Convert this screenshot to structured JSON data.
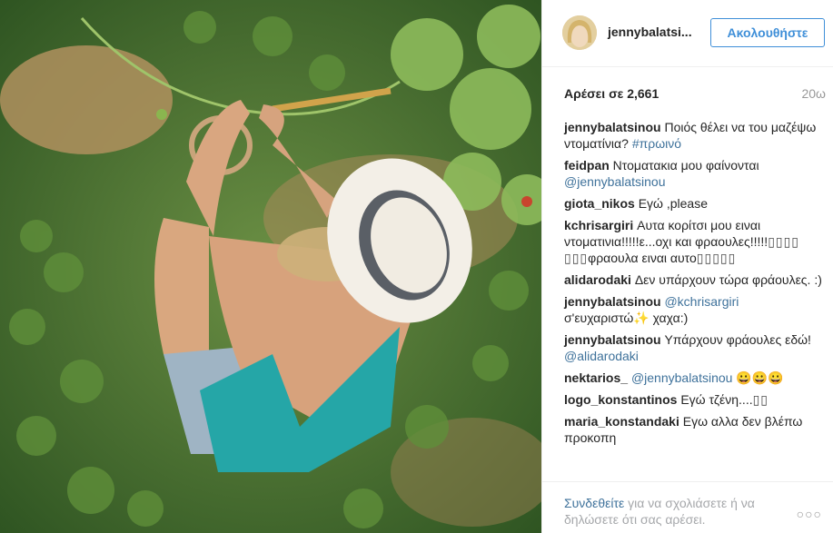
{
  "post": {
    "username": "jennybalatsi...",
    "follow_label": "Ακολουθήστε",
    "likes": "Αρέσει σε 2,661",
    "age": "20ω"
  },
  "comments": [
    {
      "user": "jennybalatsinou",
      "pre": "Ποιός θέλει να του μαζέψω ντοματίνια? ",
      "mention": "#πρωινό",
      "post": ""
    },
    {
      "user": "feidpan",
      "pre": "Ντοματακια μου φαίνονται ",
      "mention": "@jennybalatsinou",
      "post": ""
    },
    {
      "user": "giota_nikos",
      "pre": "Εγώ ,please",
      "mention": "",
      "post": ""
    },
    {
      "user": "kchrisargiri",
      "pre": "Αυτα κορίτσι μου ειναι ντοματινια!!!!!ε...οχι και φραουλες!!!!!",
      "mention": "",
      "post": "φραουλα ειναι αυτο"
    },
    {
      "user": "alidarodaki",
      "pre": "Δεν υπάρχουν τώρα φράουλες. :)",
      "mention": "",
      "post": ""
    },
    {
      "user": "jennybalatsinou",
      "pre": "",
      "mention": "@kchrisargiri",
      "post": " σ'ευχαριστώ✨ χαχα:)"
    },
    {
      "user": "jennybalatsinou",
      "pre": "Υπάρχουν φράουλες εδώ! ",
      "mention": "@alidarodaki",
      "post": ""
    },
    {
      "user": "nektarios_",
      "pre": "",
      "mention": "@jennybalatsinou",
      "post": " 😀😀😀"
    },
    {
      "user": "logo_konstantinos",
      "pre": "Εγώ τζένη....",
      "mention": "",
      "post": ""
    },
    {
      "user": "maria_konstandaki",
      "pre": "Εγω αλλα δεν βλέπω προκοπη",
      "mention": "",
      "post": ""
    }
  ],
  "footer": {
    "login_link": "Συνδεθείτε",
    "login_text": " για να σχολιάσετε ή να δηλώσετε ότι σας αρέσει.",
    "more": "○○○"
  },
  "icons": {
    "more": "more-options-icon"
  },
  "colors": {
    "accent": "#3f8fd8",
    "link": "#3f729b",
    "muted": "#a5a7aa"
  }
}
